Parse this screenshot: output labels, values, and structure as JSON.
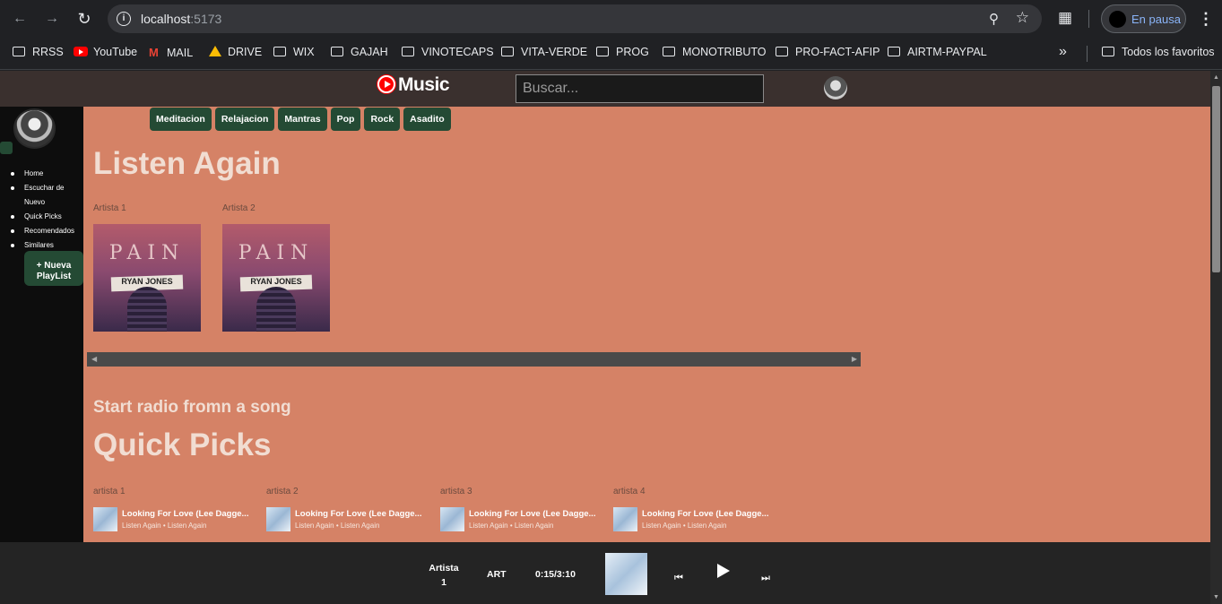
{
  "browser": {
    "url_host": "localhost",
    "url_port": ":5173",
    "profile_status": "En pausa",
    "bookmarks": [
      {
        "label": "RRSS",
        "icon": "folder-icon"
      },
      {
        "label": "YouTube",
        "icon": "youtube-icon"
      },
      {
        "label": "MAIL",
        "icon": "gmail-icon"
      },
      {
        "label": "DRIVE",
        "icon": "drive-icon"
      },
      {
        "label": "WIX",
        "icon": "folder-icon"
      },
      {
        "label": "GAJAH",
        "icon": "folder-icon"
      },
      {
        "label": "VINOTECAPS",
        "icon": "folder-icon"
      },
      {
        "label": "VITA-VERDE",
        "icon": "folder-icon"
      },
      {
        "label": "PROG",
        "icon": "folder-icon"
      },
      {
        "label": "MONOTRIBUTO",
        "icon": "folder-icon"
      },
      {
        "label": "PRO-FACT-AFIP",
        "icon": "folder-icon"
      },
      {
        "label": "AIRTM-PAYPAL",
        "icon": "folder-icon"
      }
    ],
    "all_bookmarks": "Todos los favoritos"
  },
  "app": {
    "logo_text": "Music",
    "search_placeholder": "Buscar...",
    "accent": "#244a34",
    "main_bg": "#d58266"
  },
  "sidebar": {
    "nav": [
      "Home",
      "Escuchar de Nuevo",
      "Quick Picks",
      "Recomendados",
      "Similares"
    ],
    "new_playlist": "+ Nueva PlayList"
  },
  "chips": [
    "Meditacion",
    "Relajacion",
    "Mantras",
    "Pop",
    "Rock",
    "Asadito"
  ],
  "listen_again": {
    "title": "Listen Again",
    "cards": [
      {
        "artist": "Artista 1",
        "cover_title": "PAIN",
        "cover_name": "RYAN JONES"
      },
      {
        "artist": "Artista 2",
        "cover_title": "PAIN",
        "cover_name": "RYAN JONES"
      }
    ]
  },
  "radio_title": "Start radio fromn a song",
  "quick_picks": {
    "title": "Quick Picks",
    "items": [
      {
        "artist": "artista 1",
        "title": "Looking For Love (Lee Dagge...",
        "sub": "Listen Again • Listen Again"
      },
      {
        "artist": "artista 2",
        "title": "Looking For Love (Lee Dagge...",
        "sub": "Listen Again • Listen Again"
      },
      {
        "artist": "artista 3",
        "title": "Looking For Love (Lee Dagge...",
        "sub": "Listen Again • Listen Again"
      },
      {
        "artist": "artista 4",
        "title": "Looking For Love (Lee Dagge...",
        "sub": "Listen Again • Listen Again"
      }
    ]
  },
  "player": {
    "artist_line1": "Artista",
    "artist_line2": "1",
    "art": "ART",
    "time": "0:15/3:10"
  }
}
